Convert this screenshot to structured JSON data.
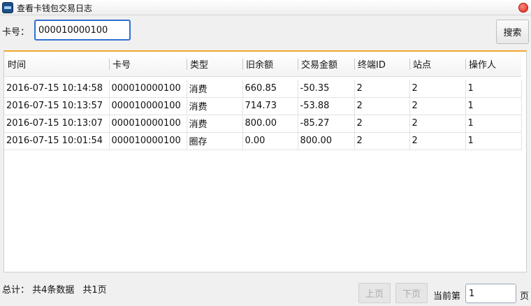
{
  "window": {
    "title": "查看卡钱包交易日志"
  },
  "search": {
    "label": "卡号：",
    "value": "000010000100",
    "button": "搜索"
  },
  "table": {
    "columns": [
      "时间",
      "卡号",
      "类型",
      "旧余额",
      "交易金额",
      "终端ID",
      "站点",
      "操作人"
    ],
    "rows": [
      [
        "2016-07-15 10:14:58",
        "000010000100",
        "消费",
        "660.85",
        "-50.35",
        "2",
        "2",
        "1"
      ],
      [
        "2016-07-15 10:13:57",
        "000010000100",
        "消费",
        "714.73",
        "-53.88",
        "2",
        "2",
        "1"
      ],
      [
        "2016-07-15 10:13:07",
        "000010000100",
        "消费",
        "800.00",
        "-85.27",
        "2",
        "2",
        "1"
      ],
      [
        "2016-07-15 10:01:54",
        "000010000100",
        "圈存",
        "0.00",
        "800.00",
        "2",
        "2",
        "1"
      ]
    ]
  },
  "footer": {
    "total": "总计：  共4条数据",
    "pages": "共1页",
    "prev": "上页",
    "next": "下页",
    "current_label": "当前第",
    "current_page": "1",
    "page_suffix": "页"
  }
}
